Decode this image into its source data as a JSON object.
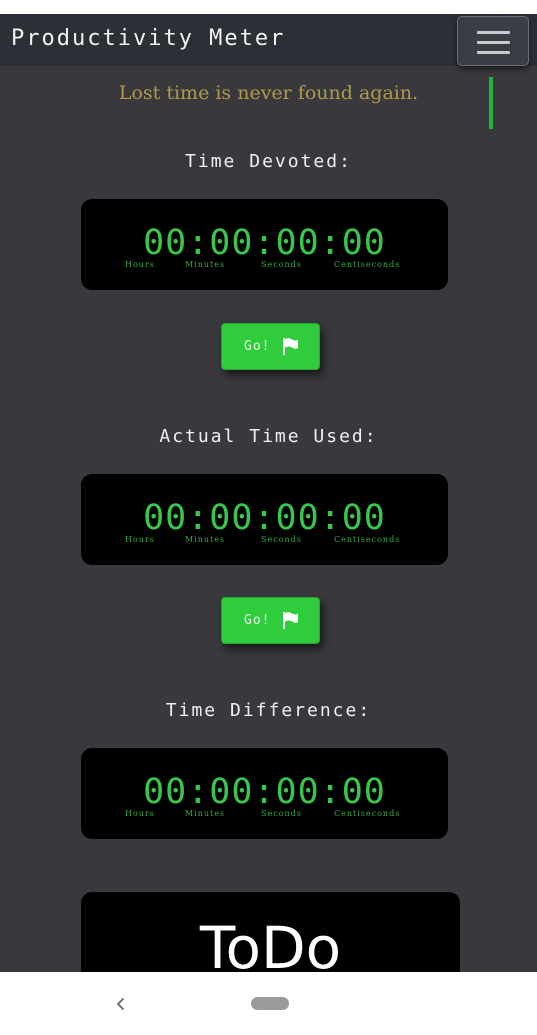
{
  "header": {
    "title": "Productivity Meter",
    "menu_icon": "hamburger-menu-icon"
  },
  "quote": "Lost time is never found again.",
  "timers": [
    {
      "title": "Time Devoted:",
      "display": "00:00:00:00",
      "units": [
        "Hours",
        "Minutes",
        "Seconds",
        "Centiseconds"
      ],
      "button_label": "Go!",
      "button_icon": "flag-icon"
    },
    {
      "title": "Actual Time Used:",
      "display": "00:00:00:00",
      "units": [
        "Hours",
        "Minutes",
        "Seconds",
        "Centiseconds"
      ],
      "button_label": "Go!",
      "button_icon": "flag-icon"
    },
    {
      "title": "Time Difference:",
      "display": "00:00:00:00",
      "units": [
        "Hours",
        "Minutes",
        "Seconds",
        "Centiseconds"
      ]
    }
  ],
  "todo": {
    "title": "ToDo"
  },
  "system_nav": {
    "back_icon": "back-chevron-icon",
    "home_icon": "home-pill-icon"
  },
  "colors": {
    "background": "#38383d",
    "navbar": "#2c2f35",
    "digit_green": "#38c64b",
    "button_green": "#2fcc3b",
    "quote_gold": "#b09a46"
  }
}
